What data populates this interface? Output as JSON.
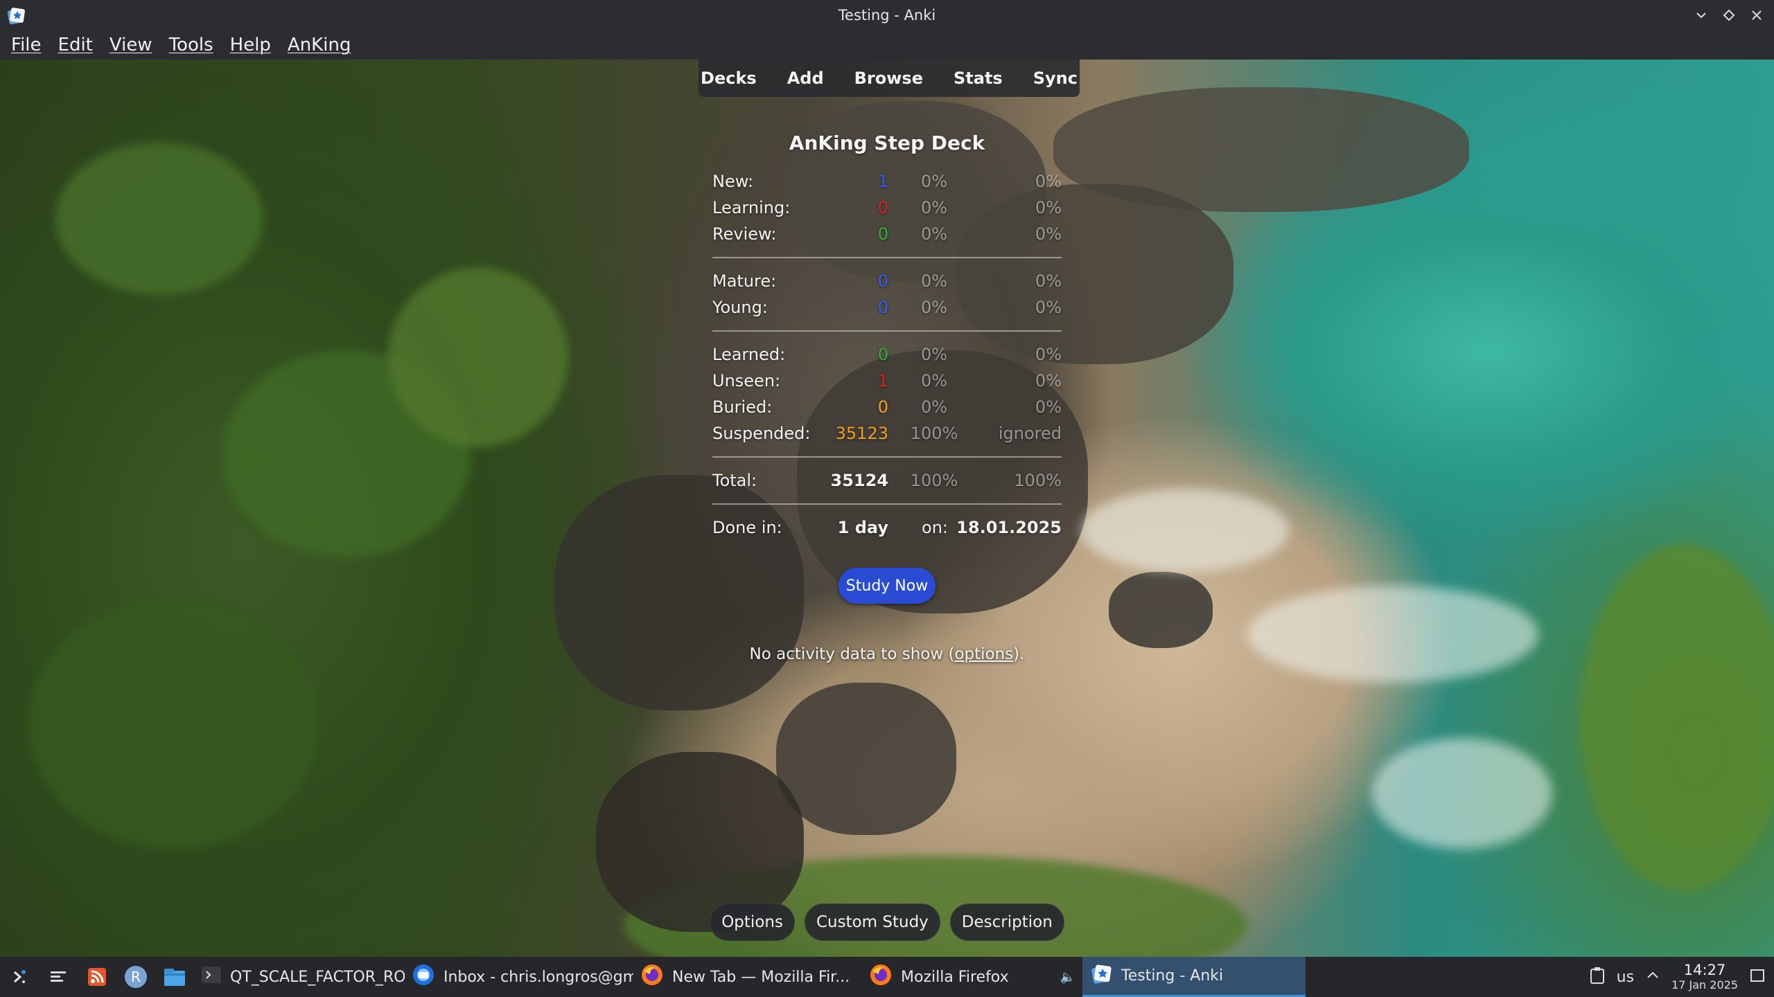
{
  "window": {
    "title": "Testing - Anki",
    "controls": [
      "minimize-icon",
      "maximize-icon",
      "close-icon"
    ]
  },
  "menu": {
    "items": [
      "File",
      "Edit",
      "View",
      "Tools",
      "Help",
      "AnKing"
    ]
  },
  "toolbar": {
    "items": [
      "Decks",
      "Add",
      "Browse",
      "Stats",
      "Sync"
    ]
  },
  "overview": {
    "deck_title": "AnKing Step Deck",
    "group1": [
      {
        "label": "New:",
        "value": "1",
        "pct1": "0%",
        "pct2": "0%",
        "color": "#2f5ef5"
      },
      {
        "label": "Learning:",
        "value": "0",
        "pct1": "0%",
        "pct2": "0%",
        "color": "#d92222"
      },
      {
        "label": "Review:",
        "value": "0",
        "pct1": "0%",
        "pct2": "0%",
        "color": "#2fb030"
      }
    ],
    "group2": [
      {
        "label": "Mature:",
        "value": "0",
        "pct1": "0%",
        "pct2": "0%",
        "color": "#2f5ef5"
      },
      {
        "label": "Young:",
        "value": "0",
        "pct1": "0%",
        "pct2": "0%",
        "color": "#2f5ef5"
      }
    ],
    "group3": [
      {
        "label": "Learned:",
        "value": "0",
        "pct1": "0%",
        "pct2": "0%",
        "color": "#2fb030"
      },
      {
        "label": "Unseen:",
        "value": "1",
        "pct1": "0%",
        "pct2": "0%",
        "color": "#d92222"
      },
      {
        "label": "Buried:",
        "value": "0",
        "pct1": "0%",
        "pct2": "0%",
        "color": "#f0a020"
      },
      {
        "label": "Suspended:",
        "value": "35123",
        "pct1": "100%",
        "pct2": "ignored",
        "color": "#f0a020"
      }
    ],
    "total": {
      "label": "Total:",
      "value": "35124",
      "pct1": "100%",
      "pct2": "100%"
    },
    "done": {
      "label": "Done in:",
      "value": "1 day",
      "on_label": "on:",
      "date": "18.01.2025"
    },
    "study_button": "Study Now",
    "activity_text": "No activity data to show (",
    "activity_link": "options",
    "activity_suffix": ")."
  },
  "bottom_buttons": [
    "Options",
    "Custom Study",
    "Description"
  ],
  "taskbar": {
    "tasks": [
      {
        "label": "QT_SCALE_FACTOR_ROUN...",
        "icon": "terminal-icon"
      },
      {
        "label": "Inbox - chris.longros@gm...",
        "icon": "thunderbird-icon"
      },
      {
        "label": "New Tab — Mozilla Fir...",
        "icon": "firefox-icon"
      },
      {
        "label": "Mozilla Firefox",
        "icon": "firefox-icon"
      },
      {
        "label": "Testing - Anki",
        "icon": "anki-icon"
      }
    ],
    "keyboard_layout": "us",
    "time": "14:27",
    "date": "17 Jan 2025"
  },
  "colors": {
    "study_button": "#2a4cd4",
    "active_task": "#34506f"
  }
}
